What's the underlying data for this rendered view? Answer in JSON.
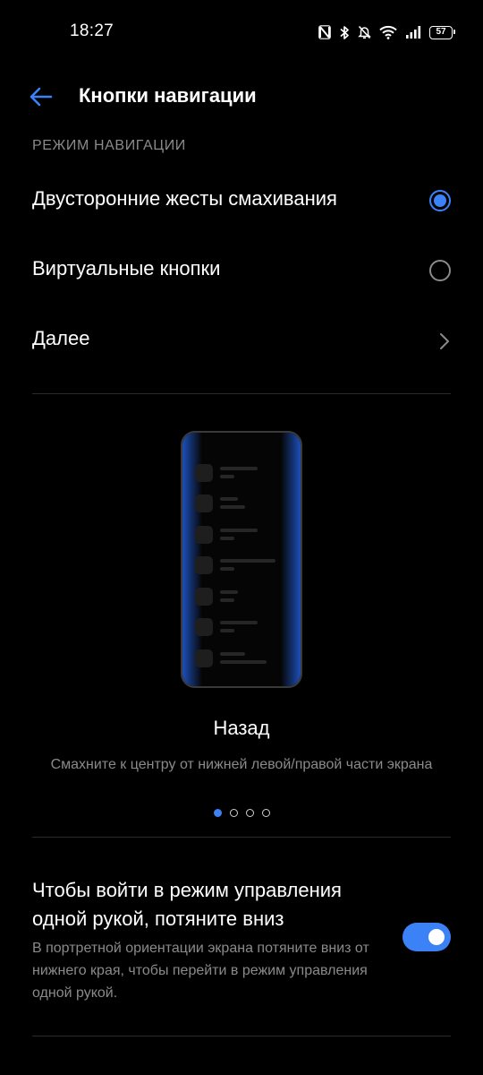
{
  "status_bar": {
    "time": "18:27",
    "battery": "57",
    "icons": [
      "nfc-icon",
      "bluetooth-icon",
      "bell-off-icon",
      "wifi-icon",
      "signal-icon",
      "battery-icon"
    ]
  },
  "header": {
    "back_icon": "arrow-left-icon",
    "title": "Кнопки навигации"
  },
  "navigation_mode": {
    "section_label": "РЕЖИМ НАВИГАЦИИ",
    "options": [
      {
        "label": "Двусторонние жесты смахивания",
        "selected": true
      },
      {
        "label": "Виртуальные кнопки",
        "selected": false
      }
    ],
    "more_label": "Далее"
  },
  "illustration": {
    "title": "Назад",
    "description": "Смахните к центру от нижней левой/правой части экрана",
    "page_count": 4,
    "current_page": 1
  },
  "one_hand": {
    "title": "Чтобы войти в режим управления одной рукой, потяните вниз",
    "description": "В портретной ориентации экрана потяните вниз от нижнего края, чтобы перейти в режим управления одной рукой.",
    "enabled": true
  },
  "colors": {
    "accent": "#3b82f6",
    "background": "#000000",
    "secondary_text": "#8a8a8a",
    "divider": "#2a2a2a"
  }
}
